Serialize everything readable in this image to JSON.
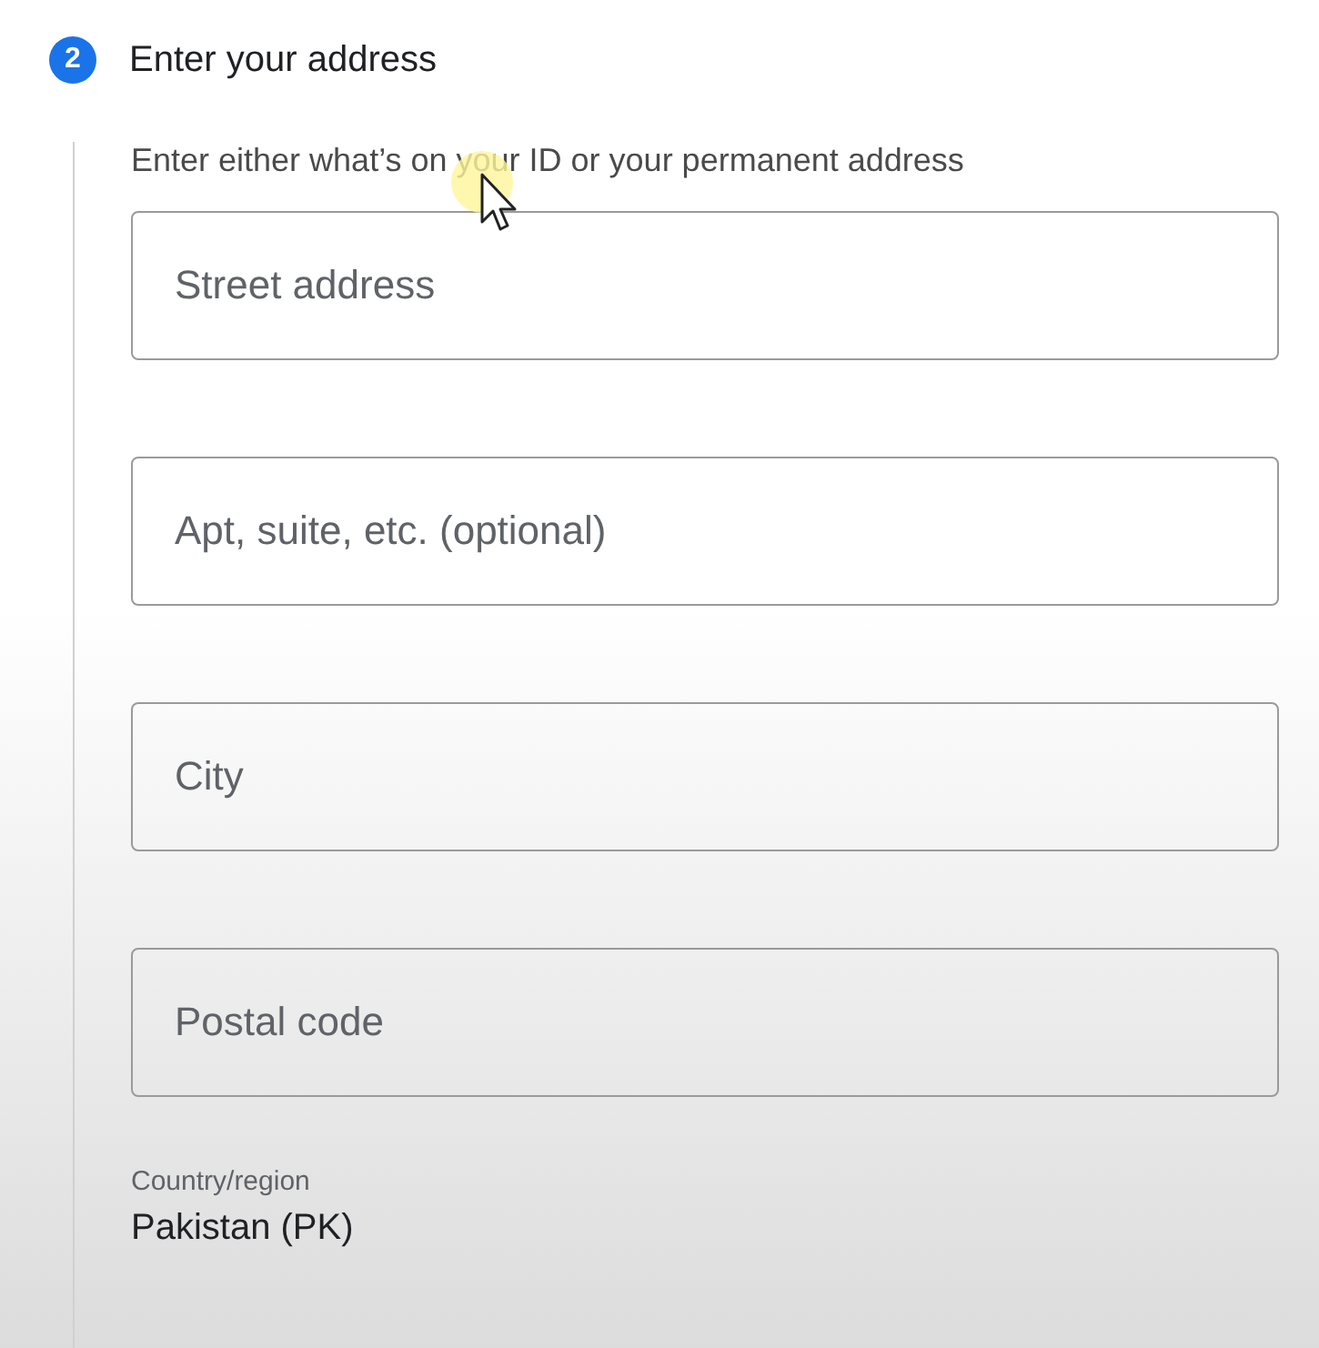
{
  "step": {
    "number": "2",
    "title": "Enter your address"
  },
  "instruction": "Enter either what’s on your ID or your permanent address",
  "fields": [
    {
      "placeholder": "Street address"
    },
    {
      "placeholder": "Apt, suite, etc. (optional)"
    },
    {
      "placeholder": "City"
    },
    {
      "placeholder": "Postal code"
    }
  ],
  "country": {
    "label": "Country/region",
    "value": "Pakistan (PK)"
  }
}
